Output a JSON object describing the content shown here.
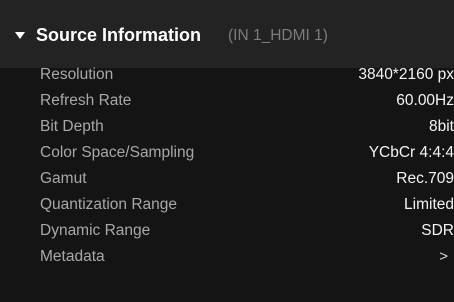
{
  "section": {
    "title": "Source Information",
    "subtitle": "(IN 1_HDMI 1)"
  },
  "rows": [
    {
      "label": "Resolution",
      "value": "3840*2160 px"
    },
    {
      "label": "Refresh Rate",
      "value": "60.00Hz"
    },
    {
      "label": "Bit Depth",
      "value": "8bit"
    },
    {
      "label": "Color Space/Sampling",
      "value": "YCbCr 4:4:4"
    },
    {
      "label": "Gamut",
      "value": "Rec.709"
    },
    {
      "label": "Quantization Range",
      "value": "Limited"
    },
    {
      "label": "Dynamic Range",
      "value": "SDR"
    },
    {
      "label": "Metadata",
      "value": ">"
    }
  ],
  "colors": {
    "background": "#141414",
    "header_background": "#232323",
    "label": "#a8a8a8",
    "value": "#f4f4f4",
    "subtitle": "#7c7c7c"
  },
  "icons": {
    "collapse": "caret-down-icon",
    "metadata": "chevron-right-icon"
  }
}
